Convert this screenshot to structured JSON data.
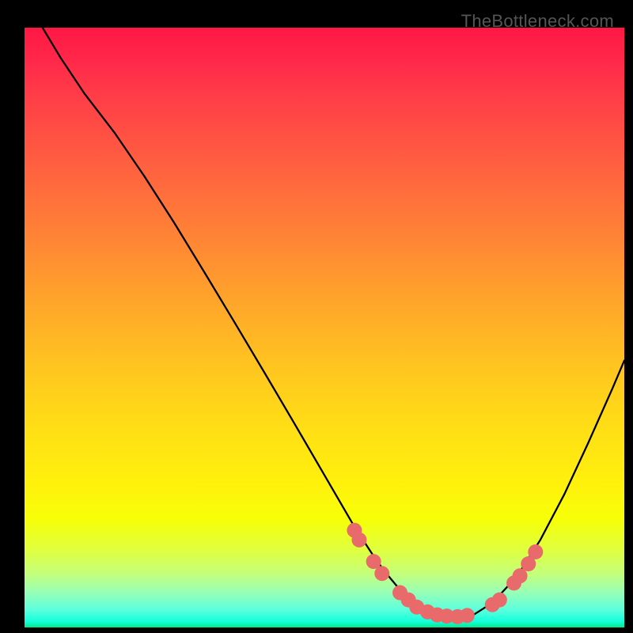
{
  "watermark": "TheBottleneck.com",
  "chart_data": {
    "type": "line",
    "title": "",
    "xlabel": "",
    "ylabel": "",
    "xlim": [
      0,
      100
    ],
    "ylim": [
      0,
      100
    ],
    "series": [
      {
        "name": "curve",
        "x": [
          0,
          3,
          6,
          10,
          15,
          20,
          25,
          30,
          35,
          40,
          45,
          50,
          55,
          58,
          60,
          62,
          64,
          66,
          68,
          70,
          72,
          75,
          78,
          82,
          86,
          90,
          94,
          98,
          100
        ],
        "y": [
          106,
          100,
          95,
          89,
          82.5,
          75.2,
          67.4,
          59.2,
          50.9,
          42.5,
          34,
          25.4,
          16.8,
          12.2,
          9.4,
          7.0,
          5.0,
          3.5,
          2.4,
          1.8,
          1.6,
          2.2,
          4.1,
          8.4,
          14.6,
          22.2,
          30.8,
          39.8,
          44.5
        ]
      }
    ],
    "markers": [
      {
        "x": 55.0,
        "y": 16.2
      },
      {
        "x": 55.8,
        "y": 14.6
      },
      {
        "x": 58.2,
        "y": 11.0
      },
      {
        "x": 59.6,
        "y": 9.0
      },
      {
        "x": 62.6,
        "y": 5.8
      },
      {
        "x": 64.0,
        "y": 4.6
      },
      {
        "x": 65.4,
        "y": 3.4
      },
      {
        "x": 67.2,
        "y": 2.6
      },
      {
        "x": 68.8,
        "y": 2.1
      },
      {
        "x": 70.4,
        "y": 1.9
      },
      {
        "x": 72.2,
        "y": 1.8
      },
      {
        "x": 73.8,
        "y": 2.0
      },
      {
        "x": 78.0,
        "y": 3.8
      },
      {
        "x": 79.2,
        "y": 4.6
      },
      {
        "x": 81.6,
        "y": 7.4
      },
      {
        "x": 82.6,
        "y": 8.6
      },
      {
        "x": 84.0,
        "y": 10.6
      },
      {
        "x": 85.2,
        "y": 12.6
      }
    ],
    "marker_color": "#e86a6a",
    "marker_radius_px": 9.5
  }
}
